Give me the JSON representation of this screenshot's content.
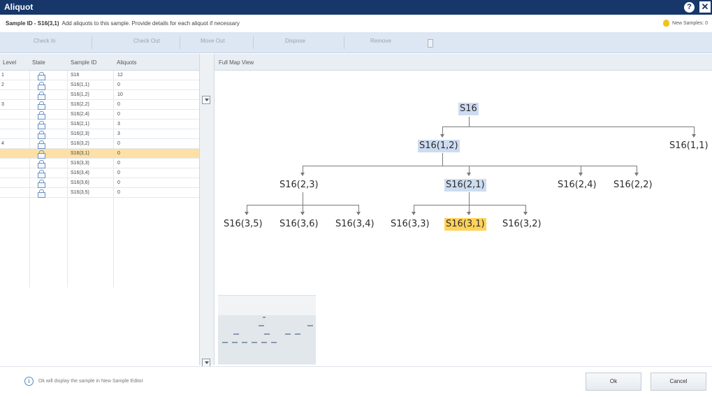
{
  "window": {
    "title": "Aliquot",
    "help_label": "?",
    "close_label": "✕"
  },
  "info": {
    "sample_prefix": "Sample ID - ",
    "sample_id": "S16(3,1)",
    "instruction": "Add aliquots to this sample. Provide details for each aliquot if necessary",
    "new_samples": "New Samples: 0"
  },
  "toolbar": {
    "check_in": "Check In",
    "check_out": "Check Out",
    "move_out": "Move Out",
    "dispose": "Dispose",
    "remove": "Remove"
  },
  "grid": {
    "headers": [
      "Level",
      "State",
      "Sample ID",
      "Aliquots"
    ],
    "rows": [
      {
        "level": "1",
        "sample_id": "S16",
        "aliquots": "12"
      },
      {
        "level": "2",
        "sample_id": "S16(1,1)",
        "aliquots": "0"
      },
      {
        "level": "",
        "sample_id": "S16(1,2)",
        "aliquots": "10"
      },
      {
        "level": "3",
        "sample_id": "S16(2,2)",
        "aliquots": "0"
      },
      {
        "level": "",
        "sample_id": "S16(2,4)",
        "aliquots": "0"
      },
      {
        "level": "",
        "sample_id": "S16(2,1)",
        "aliquots": "3"
      },
      {
        "level": "",
        "sample_id": "S16(2,3)",
        "aliquots": "3"
      },
      {
        "level": "4",
        "sample_id": "S16(3,2)",
        "aliquots": "0"
      },
      {
        "level": "",
        "sample_id": "S16(3,1)",
        "aliquots": "0"
      },
      {
        "level": "",
        "sample_id": "S16(3,3)",
        "aliquots": "0"
      },
      {
        "level": "",
        "sample_id": "S16(3,4)",
        "aliquots": "0"
      },
      {
        "level": "",
        "sample_id": "S16(3,6)",
        "aliquots": "0"
      },
      {
        "level": "",
        "sample_id": "S16(3,5)",
        "aliquots": "0"
      }
    ],
    "selected_sample": "S16(3,1)"
  },
  "map": {
    "title": "Full Map View",
    "nodes": {
      "root": "S16",
      "n12": "S16(1,2)",
      "n11": "S16(1,1)",
      "n23": "S16(2,3)",
      "n21": "S16(2,1)",
      "n24": "S16(2,4)",
      "n22": "S16(2,2)",
      "n35": "S16(3,5)",
      "n36": "S16(3,6)",
      "n34": "S16(3,4)",
      "n33": "S16(3,3)",
      "n31": "S16(3,1)",
      "n32": "S16(3,2)"
    }
  },
  "footer": {
    "info_icon": "i",
    "message": "Ok will display the sample in New Sample Editor",
    "ok": "Ok",
    "cancel": "Cancel"
  }
}
